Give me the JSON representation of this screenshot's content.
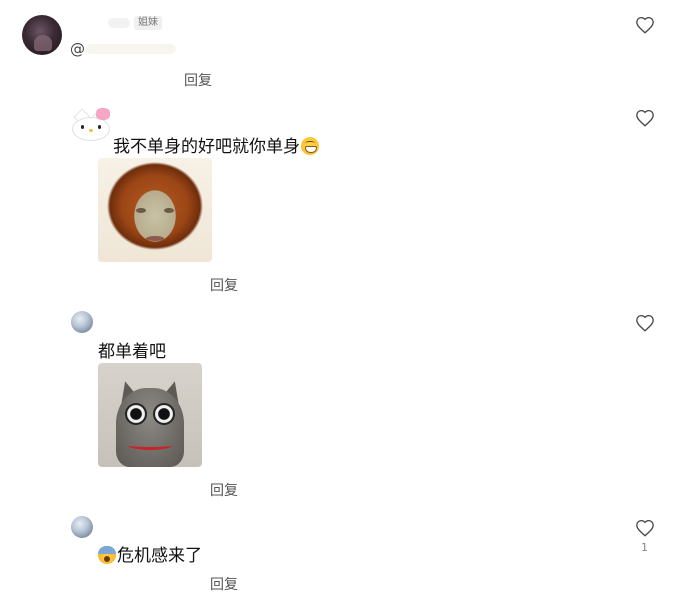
{
  "comments": [
    {
      "badge": "姐妹",
      "at_text": "@",
      "reply_label": "回复"
    },
    {
      "text": "我不单身的好吧就你单身",
      "emoji": "grinning-emoji",
      "reply_label": "回复"
    },
    {
      "text": "都单着吧",
      "reply_label": "回复"
    },
    {
      "text": "危机感来了",
      "emoji": "fearful-emoji",
      "reply_label": "回复",
      "like_count": "1"
    }
  ],
  "icons": {
    "like": "heart-outline-icon"
  },
  "colors": {
    "text": "#111111",
    "secondary": "#555555",
    "muted": "#aaaaaa",
    "heart": "#444444"
  }
}
